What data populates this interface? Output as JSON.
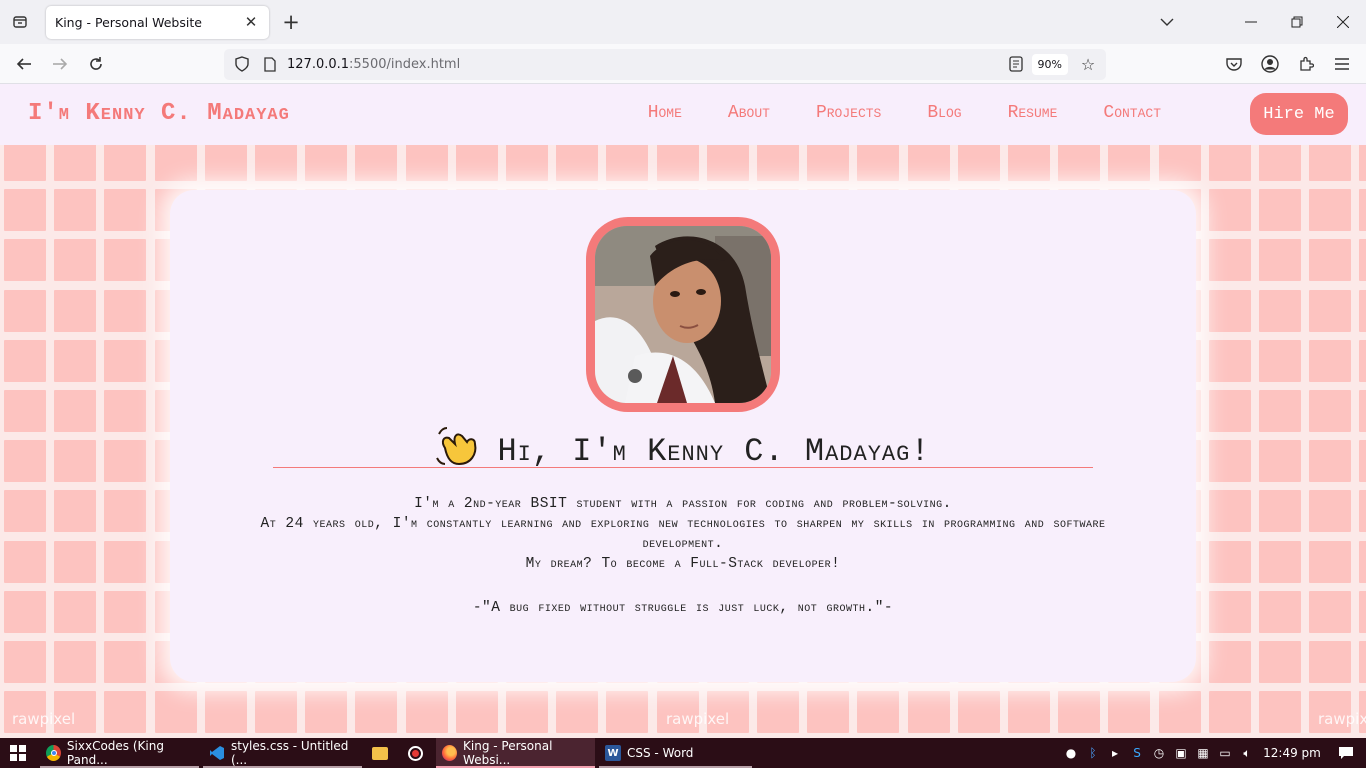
{
  "browser": {
    "tab_title": "King - Personal Website",
    "url_host": "127.0.0.1",
    "url_rest": ":5500/index.html",
    "zoom": "90%"
  },
  "site": {
    "logo": "I'm Kenny C. Madayag",
    "nav": [
      "Home",
      "About",
      "Projects",
      "Blog",
      "Resume",
      "Contact"
    ],
    "hire_button": "Hire Me",
    "greeting": "Hi, I'm Kenny C. Madayag!",
    "intro_lines": [
      "I'm a 2nd-year BSIT student with a passion for coding and problem-solving.",
      "At 24 years old, I'm constantly learning and exploring new technologies to sharpen my skills in programming and software development.",
      "My dream? To become a Full-Stack developer!"
    ],
    "quote": "-\"A bug fixed without struggle is just luck, not growth.\"-",
    "watermark": "rawpixel",
    "accent_color": "#f47a7a",
    "card_color": "#f8effc"
  },
  "taskbar": {
    "items": [
      {
        "label": "SixxCodes (King Pand...",
        "icon": "chrome-icon"
      },
      {
        "label": "styles.css - Untitled (...",
        "icon": "vscode-icon"
      },
      {
        "label": "",
        "icon": "file-explorer-icon"
      },
      {
        "label": "",
        "icon": "record-icon"
      },
      {
        "label": "King - Personal Websi...",
        "icon": "firefox-icon"
      },
      {
        "label": "CSS - Word",
        "icon": "word-icon"
      }
    ],
    "clock": "12:49 pm"
  }
}
